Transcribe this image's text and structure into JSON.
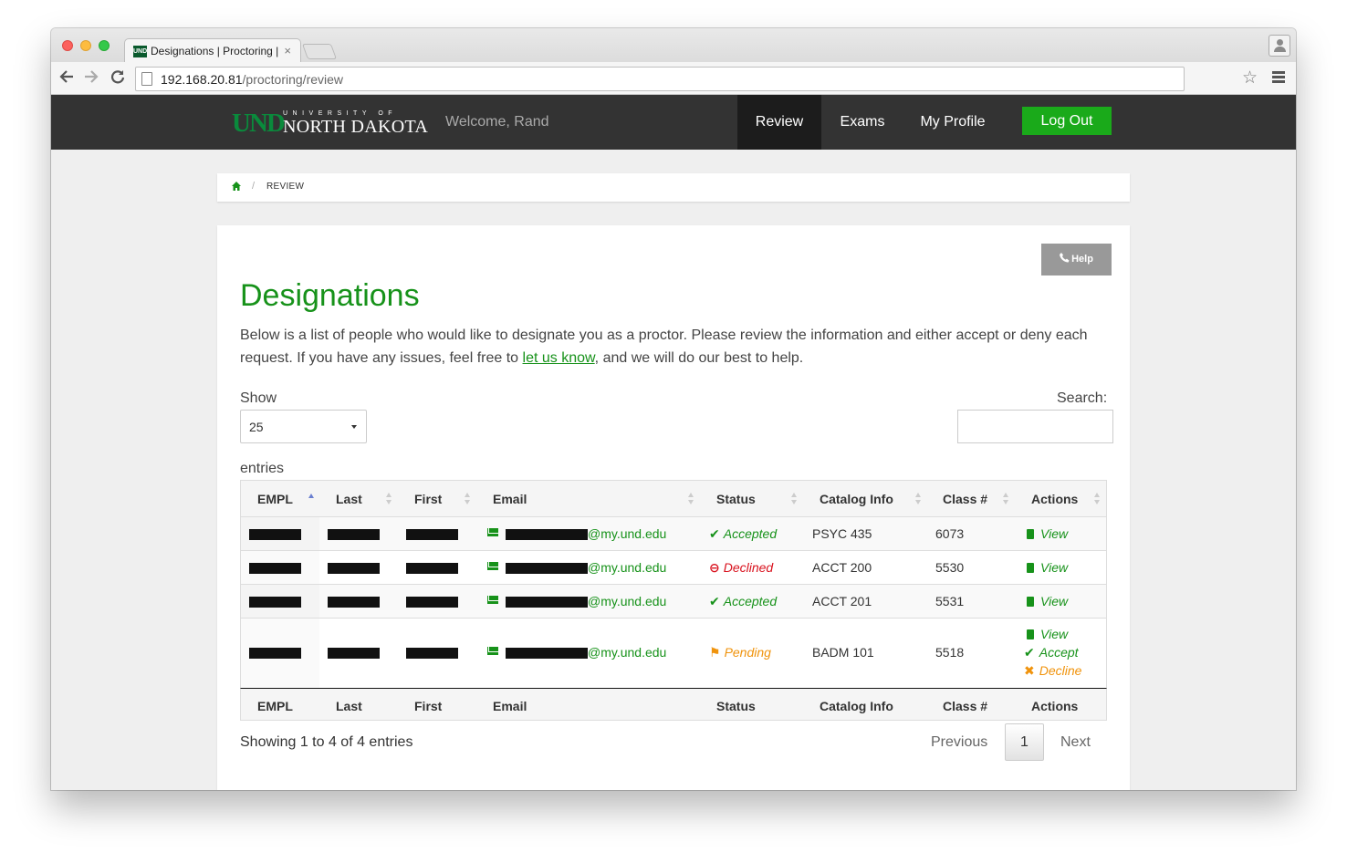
{
  "browser": {
    "tab_title": "Designations | Proctoring |",
    "tab_close": "×",
    "favicon_text": "UND",
    "url_host": "192.168.20.81",
    "url_path": "/proctoring/review",
    "star": "☆"
  },
  "header": {
    "logo_und": "UND",
    "logo_university": "UNIVERSITY OF",
    "logo_name": "NORTH DAKOTA",
    "welcome": "Welcome, Rand",
    "nav": {
      "review": "Review",
      "exams": "Exams",
      "profile": "My Profile"
    },
    "logout": "Log Out"
  },
  "breadcrumb": {
    "separator": "/",
    "current": "REVIEW"
  },
  "help_label": "Help",
  "page_title": "Designations",
  "intro": {
    "before_link": "Below is a list of people who would like to designate you as a proctor. Please review the information and either accept or deny each request. If you have any issues, feel free to ",
    "link": "let us know",
    "after_link": ", and we will do our best to help."
  },
  "length": {
    "label": "Show",
    "value": "25",
    "suffix": "entries"
  },
  "search": {
    "label": "Search:",
    "value": ""
  },
  "table": {
    "columns": [
      "EMPL",
      "Last",
      "First",
      "Email",
      "Status",
      "Catalog Info",
      "Class #",
      "Actions"
    ],
    "rows": [
      {
        "email_suffix": "@my.und.edu",
        "status": "Accepted",
        "catalog": "PSYC 435",
        "class_no": "6073",
        "actions": [
          "View"
        ]
      },
      {
        "email_suffix": "@my.und.edu",
        "status": "Declined",
        "catalog": "ACCT 200",
        "class_no": "5530",
        "actions": [
          "View"
        ]
      },
      {
        "email_suffix": "@my.und.edu",
        "status": "Accepted",
        "catalog": "ACCT 201",
        "class_no": "5531",
        "actions": [
          "View"
        ]
      },
      {
        "email_suffix": "@my.und.edu",
        "status": "Pending",
        "catalog": "BADM 101",
        "class_no": "5518",
        "actions": [
          "View",
          "Accept",
          "Decline"
        ]
      }
    ]
  },
  "info": "Showing 1 to 4 of 4 entries",
  "pagination": {
    "previous": "Previous",
    "current": "1",
    "next": "Next"
  },
  "icons": {
    "status_accepted": "check-icon",
    "status_declined": "minus-circle-icon",
    "status_pending": "flag-icon",
    "action_view": "document-icon",
    "action_accept": "check-icon",
    "action_decline": "x-icon",
    "email": "envelope-icon",
    "help": "phone-icon",
    "breadcrumb_home": "home-icon"
  },
  "colors": {
    "brand_green": "#17921a",
    "header_bg": "#333333",
    "logout_bg": "#1aaa1a",
    "declined": "#d9121e",
    "pending": "#f0930c",
    "help_bg": "#999999"
  }
}
